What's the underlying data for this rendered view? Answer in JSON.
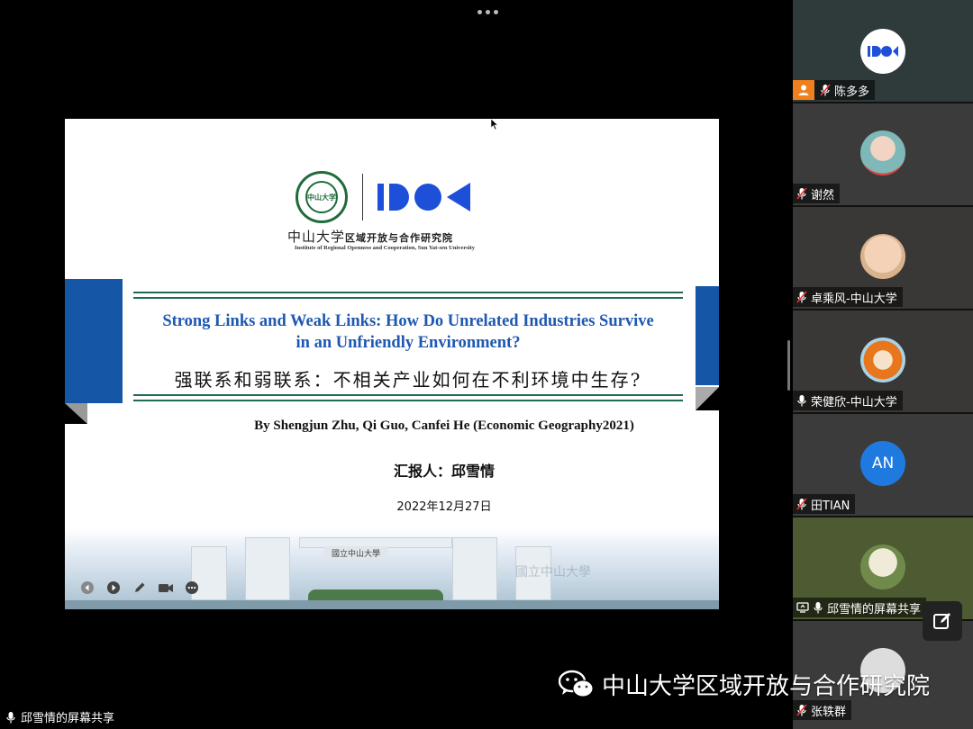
{
  "slide": {
    "institute_cn": "中山大学",
    "institute_cn_small": "区域开放与合作研究院",
    "institute_en": "Institute of Regional Openness and Cooperation, Sun Yat-sen University",
    "seal_text": "中山大学",
    "title_en_line1": "Strong Links and Weak Links: How Do Unrelated Industries Survive",
    "title_en_line2": "in an Unfriendly Environment?",
    "title_cn": "强联系和弱联系：不相关产业如何在不利环境中生存?",
    "byline": "By Shengjun Zhu, Qi Guo, Canfei He  (Economic Geography2021)",
    "reporter": "汇报人：邱雪情",
    "date": "2022年12月27日",
    "gate_sign": "國立中山大學"
  },
  "participants": [
    {
      "name": "陈多多",
      "host": true
    },
    {
      "name": "谢然"
    },
    {
      "name": "卓乘风-中山大学"
    },
    {
      "name": "荣健欣-中山大学"
    },
    {
      "name": "田TIAN",
      "initials": "AN"
    },
    {
      "name": "邱雪情的屏幕共享"
    },
    {
      "name": "张轶群"
    }
  ],
  "watermark": "中山大学区域开放与合作研究院",
  "share_status": "邱雪情的屏幕共享",
  "colors": {
    "slide_blue": "#1556a6",
    "title_blue": "#1e58b0",
    "rule_green": "#1f6b54",
    "logo_blue": "#1e4fd8",
    "host_orange": "#f0801e",
    "avatar_blue": "#1f7ae0"
  }
}
